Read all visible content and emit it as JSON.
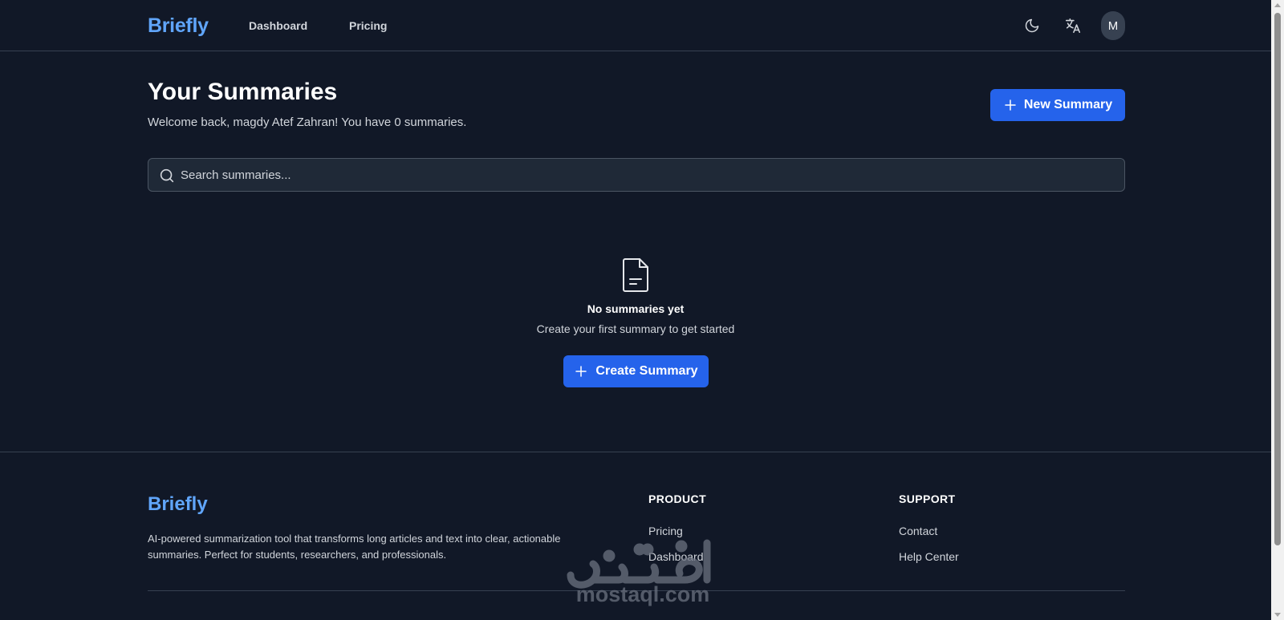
{
  "header": {
    "logo": "Briefly",
    "nav": {
      "dashboard": "Dashboard",
      "pricing": "Pricing"
    },
    "avatar_initial": "M",
    "icons": {
      "theme": "moon-icon",
      "language": "translate-icon"
    }
  },
  "main": {
    "title": "Your Summaries",
    "subtitle": "Welcome back, magdy Atef Zahran! You have 0 summaries.",
    "new_summary_label": "New Summary",
    "search": {
      "placeholder": "Search summaries...",
      "value": ""
    },
    "empty_state": {
      "title": "No summaries yet",
      "subtitle": "Create your first summary to get started",
      "cta_label": "Create Summary"
    }
  },
  "footer": {
    "logo": "Briefly",
    "description": "AI-powered summarization tool that transforms long articles and text into clear, actionable summaries. Perfect for students, researchers, and professionals.",
    "product": {
      "heading": "PRODUCT",
      "links": [
        "Pricing",
        "Dashboard"
      ]
    },
    "support": {
      "heading": "SUPPORT",
      "links": [
        "Contact",
        "Help Center"
      ]
    }
  },
  "watermark": {
    "text": "mostaql.com"
  },
  "colors": {
    "background": "#111827",
    "accent": "#2563eb",
    "logo": "#60a5fa",
    "border": "#374151"
  }
}
